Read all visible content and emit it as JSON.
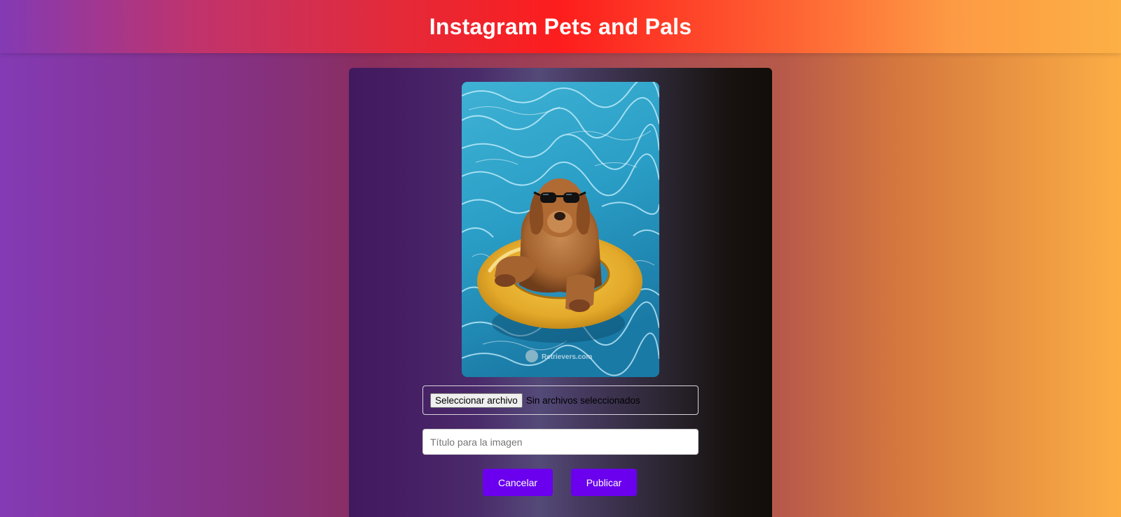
{
  "header": {
    "title": "Instagram Pets and Pals"
  },
  "upload": {
    "file_button_label": "Seleccionar archivo",
    "file_status": "Sin archivos seleccionados",
    "title_placeholder": "Título para la imagen",
    "title_value": ""
  },
  "preview": {
    "alt": "Golden retriever with sunglasses on a yellow pool float",
    "watermark": "Retrievers.com"
  },
  "actions": {
    "cancel_label": "Cancelar",
    "publish_label": "Publicar"
  },
  "colors": {
    "button": "#6a00ee",
    "header_gradient": [
      "#833ab4",
      "#fd1d1d",
      "#fcb045"
    ]
  }
}
